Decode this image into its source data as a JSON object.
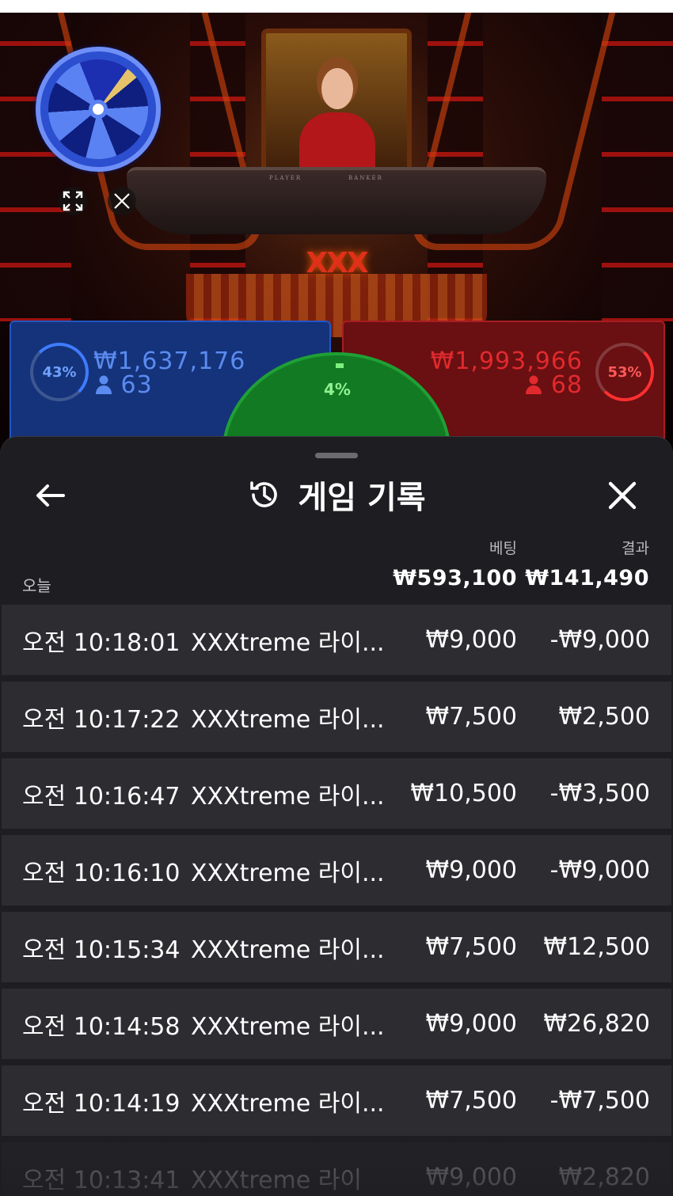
{
  "game_view": {
    "table_labels": {
      "player": "PLAYER",
      "banker": "BANKER"
    },
    "logo_text": "XXX",
    "wheel_icon": "fortune-wheel-icon",
    "fullscreen_icon": "expand-icon",
    "close_icon": "close-icon",
    "player": {
      "percent": "43%",
      "amount": "₩1,637,176",
      "count": "63",
      "color": "#2355c2"
    },
    "banker": {
      "percent": "53%",
      "amount": "₩1,993,966",
      "count": "68",
      "color": "#a81d22"
    },
    "tie": {
      "percent": "4%",
      "color": "#137a24"
    }
  },
  "history": {
    "title": "게임 기록",
    "title_icon": "history-icon",
    "back_icon": "arrow-left-icon",
    "close_icon": "close-icon",
    "section_label": "오늘",
    "columns": {
      "bet": "베팅",
      "result": "결과"
    },
    "totals": {
      "bet": "₩593,100",
      "result": "₩141,490"
    },
    "rows": [
      {
        "time": "오전 10:18:01",
        "game": "XXXtreme 라이...",
        "bet": "₩9,000",
        "result": "-₩9,000"
      },
      {
        "time": "오전 10:17:22",
        "game": "XXXtreme 라이...",
        "bet": "₩7,500",
        "result": "₩2,500"
      },
      {
        "time": "오전 10:16:47",
        "game": "XXXtreme 라이...",
        "bet": "₩10,500",
        "result": "-₩3,500"
      },
      {
        "time": "오전 10:16:10",
        "game": "XXXtreme 라이...",
        "bet": "₩9,000",
        "result": "-₩9,000"
      },
      {
        "time": "오전 10:15:34",
        "game": "XXXtreme 라이...",
        "bet": "₩7,500",
        "result": "₩12,500"
      },
      {
        "time": "오전 10:14:58",
        "game": "XXXtreme 라이...",
        "bet": "₩9,000",
        "result": "₩26,820"
      },
      {
        "time": "오전 10:14:19",
        "game": "XXXtreme 라이...",
        "bet": "₩7,500",
        "result": "-₩7,500"
      },
      {
        "time": "오전 10:13:41",
        "game": "XXXtreme 라이",
        "bet": "₩9,000",
        "result": "₩2,820"
      }
    ]
  }
}
